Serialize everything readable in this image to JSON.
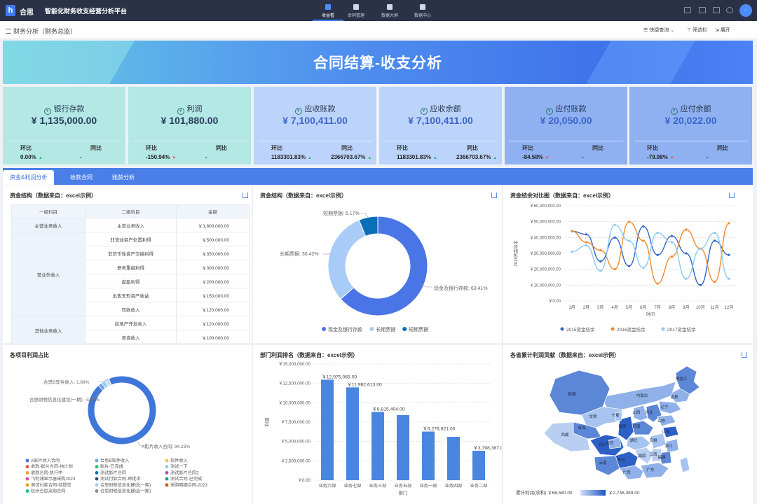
{
  "app": {
    "brand": "合思",
    "title": "智能化财务收支经营分析平台",
    "avatar": "..."
  },
  "nav": [
    {
      "label": "收益看"
    },
    {
      "label": "合同管理"
    },
    {
      "label": "数据大屏"
    },
    {
      "label": "数据中心"
    }
  ],
  "breadcrumb": "财务分析（财务总监）",
  "toolbar": {
    "quick_query": "快捷查询",
    "filter": "筛选栏",
    "expand": "展开"
  },
  "banner_title": "合同结算-收支分析",
  "kpis": [
    {
      "title": "银行存款",
      "value": "¥ 1,135,000.00",
      "l1": "环比",
      "v1": "0.00%",
      "l2": "同比",
      "v2": "-",
      "bg": "#b3e8e4"
    },
    {
      "title": "利润",
      "value": "¥ 101,880.00",
      "l1": "环比",
      "v1": "-150.94%",
      "l2": "同比",
      "v2": "-",
      "bg": "#b3e8e4"
    },
    {
      "title": "应收账款",
      "value": "¥ 7,100,411.00",
      "l1": "环比",
      "v1": "1183301.83%",
      "l2": "同比",
      "v2": "2366703.67%",
      "bg": "#bcd4fb"
    },
    {
      "title": "应收余额",
      "value": "¥ 7,100,411.00",
      "l1": "环比",
      "v1": "1183301.83%",
      "l2": "同比",
      "v2": "2366703.67%",
      "bg": "#bcd4fb"
    },
    {
      "title": "应付账款",
      "value": "¥ 20,050.00",
      "l1": "环比",
      "v1": "-84.58%",
      "l2": "同比",
      "v2": "-",
      "bg": "#8fb1f2"
    },
    {
      "title": "应付余额",
      "value": "¥ 20,022.00",
      "l1": "环比",
      "v1": "-79.98%",
      "l2": "同比",
      "v2": "-",
      "bg": "#8fb1f2"
    }
  ],
  "tabs": [
    {
      "label": "资金&利润分析"
    },
    {
      "label": "收款合同"
    },
    {
      "label": "账龄分析"
    }
  ],
  "panels": {
    "fund_table_title": "资金结构（数据来自：excel示例）",
    "donut1_title": "资金结构（数据来自：excel示例）",
    "line_title": "资金结余对比图（数据来自：excel示例）",
    "donut2_title": "各项目利润占比",
    "bar_title": "部门利润排名（数据来自：excel示例）",
    "map_title": "各省累计利润贡献（数据来自：excel示例）"
  },
  "fund_table": {
    "headers": [
      "一级科目",
      "二级科目",
      "金额"
    ],
    "groups": [
      {
        "label": "主营业务收入"
      },
      {
        "label": "营业外收入"
      },
      {
        "label": "其他业务收入"
      }
    ],
    "rows": [
      {
        "sub": "主营业务收入",
        "amt": "￥3,800,000.00"
      },
      {
        "sub": "非流动资产处置利得",
        "amt": "￥500,000.00"
      },
      {
        "sub": "非货币性资产交换利得",
        "amt": "￥350,000.00"
      },
      {
        "sub": "债务重组利得",
        "amt": "￥300,000.00"
      },
      {
        "sub": "盘盈利得",
        "amt": "￥200,000.00"
      },
      {
        "sub": "出售无形资产收益",
        "amt": "￥150,000.00"
      },
      {
        "sub": "罚款收入",
        "amt": "￥120,000.00"
      },
      {
        "sub": "房地产开发收入",
        "amt": "￥120,000.00"
      },
      {
        "sub": "咨询收入",
        "amt": "￥100,000.00"
      }
    ]
  },
  "chart_data": [
    {
      "type": "pie",
      "title": "资金结构（数据来自：excel示例）",
      "slices": [
        {
          "name": "现金及银行存款",
          "value": 63.41,
          "color": "#4a75e6"
        },
        {
          "name": "长期票据",
          "value": 30.42,
          "color": "#a8ccf7"
        },
        {
          "name": "短期票据",
          "value": 6.17,
          "color": "#0b6fb8"
        }
      ],
      "slice_labels": [
        "现金及银行存款: 63.41%",
        "长期票据: 30.42%",
        "短期票据: 6.17%"
      ]
    },
    {
      "type": "line",
      "title": "资金结余对比图（数据来自：excel示例）",
      "xlabel": "时间",
      "ylabel": "2015资金结余",
      "categories": [
        "1月",
        "2月",
        "3月",
        "4月",
        "5月",
        "6月",
        "7月",
        "8月",
        "9月",
        "10月",
        "11月",
        "12月"
      ],
      "ylim": [
        0,
        60000000
      ],
      "yticks": [
        "￥0.00",
        "￥10,000,000.00",
        "￥20,000,000.00",
        "￥30,000,000.00",
        "￥40,000,000.00",
        "￥50,000,000.00",
        "￥60,000,000.00"
      ],
      "series": [
        {
          "name": "2015资金结余",
          "color": "#2f65c7",
          "values": [
            44000000,
            42000000,
            25000000,
            40000000,
            22000000,
            47000000,
            29000000,
            41000000,
            30000000,
            10000000,
            38000000,
            29000000
          ]
        },
        {
          "name": "2016资金结余",
          "color": "#ef8a2c",
          "values": [
            44000000,
            37000000,
            32000000,
            20000000,
            50000000,
            38000000,
            11000000,
            28000000,
            45000000,
            33000000,
            12000000,
            49000000
          ]
        },
        {
          "name": "2017资金结余",
          "color": "#8ccaf0",
          "values": [
            31000000,
            35000000,
            19000000,
            48000000,
            38000000,
            21000000,
            43000000,
            37000000,
            14000000,
            33000000,
            43000000,
            14000000
          ]
        }
      ]
    },
    {
      "type": "pie",
      "title": "各项目利润占比",
      "slices": [
        {
          "name": "A影片收入合同",
          "value": 94.23,
          "color": "#3f76d9"
        },
        {
          "name": "合思B软件收入",
          "value": 1.88,
          "color": "#6aa8e6"
        },
        {
          "name": "合思财税信息化建设(一期)",
          "value": 1.88,
          "color": "#9fcdf2"
        },
        {
          "name": "其他",
          "value": 2.01,
          "color": "#c3def8"
        }
      ],
      "slice_labels": [
        "A影片收入合同: 94.23%",
        "合思B软件收入: 1.88%",
        "合思财税信息化建设(一期): -1.88%"
      ],
      "legend": [
        {
          "name": "A影片收入合同",
          "color": "#3f76d9"
        },
        {
          "name": "合思B软件收入",
          "color": "#6aa8e6"
        },
        {
          "name": "软件收入",
          "color": "#f2c94c"
        },
        {
          "name": "收款-影片合同-待计划",
          "color": "#e8523d"
        },
        {
          "name": "影片-已完成",
          "color": "#2bb673"
        },
        {
          "name": "测试一下",
          "color": "#8ccaf0"
        },
        {
          "name": "收款合同-执行中",
          "color": "#e8a33d"
        },
        {
          "name": "测试影片合同",
          "color": "#0b6fb8"
        },
        {
          "name": "测试影片合同2",
          "color": "#9b59b6"
        },
        {
          "name": "飞利浦显示器采购2023",
          "color": "#e84393"
        },
        {
          "name": "测试付款合同-审批中",
          "color": "#34495e"
        },
        {
          "name": "测试合同-已完成",
          "color": "#16a085"
        },
        {
          "name": "测试付款合同-待提交",
          "color": "#f39c12"
        },
        {
          "name": "合思财税信息化建设(一期)",
          "color": "#9fcdf2"
        },
        {
          "name": "采购明细合同-2023",
          "color": "#d35400"
        },
        {
          "name": "杭州合思采购合同",
          "color": "#1abc9c"
        },
        {
          "name": "合思财税信息化建设(一期)",
          "color": "#7f8c8d"
        }
      ]
    },
    {
      "type": "bar",
      "title": "部门利润排名（数据来自：excel示例）",
      "xlabel": "部门",
      "ylabel": "利润",
      "categories": [
        "业务六部",
        "业务七部",
        "业务三部",
        "业务五部",
        "业务一部",
        "业务四部",
        "业务二部"
      ],
      "values": [
        12975065,
        11982613,
        8815404,
        8400000,
        6276821,
        5600000,
        3798387
      ],
      "data_labels": [
        "￥12,975,065.00",
        "￥11,982,613.00",
        "￥8,815,404.00",
        "",
        "￥6,276,821.00",
        "",
        "￥3,798,387.00"
      ],
      "ylim": [
        0,
        15000000
      ],
      "yticks": [
        "￥0.00",
        "￥2,500,000.00",
        "￥5,000,000.00",
        "￥7,500,000.00",
        "￥10,000,000.00",
        "￥12,500,000.00",
        "￥15,000,000.00"
      ],
      "color": "#4a86e0"
    }
  ],
  "map": {
    "provinces": [
      "黑龙江",
      "吉林",
      "辽宁",
      "内蒙古",
      "新疆",
      "甘肃",
      "青海",
      "西藏",
      "四川",
      "云南",
      "贵州",
      "广西",
      "广东",
      "湖南",
      "湖北",
      "河南",
      "山西",
      "陕西",
      "河北",
      "山东",
      "安徽",
      "江苏",
      "浙江",
      "福建",
      "江西",
      "宁夏",
      "重庆"
    ],
    "legend_label": "累计利润(求和):",
    "legend_min": "￥68,580.00",
    "legend_max": "￥2,746,389.00"
  }
}
